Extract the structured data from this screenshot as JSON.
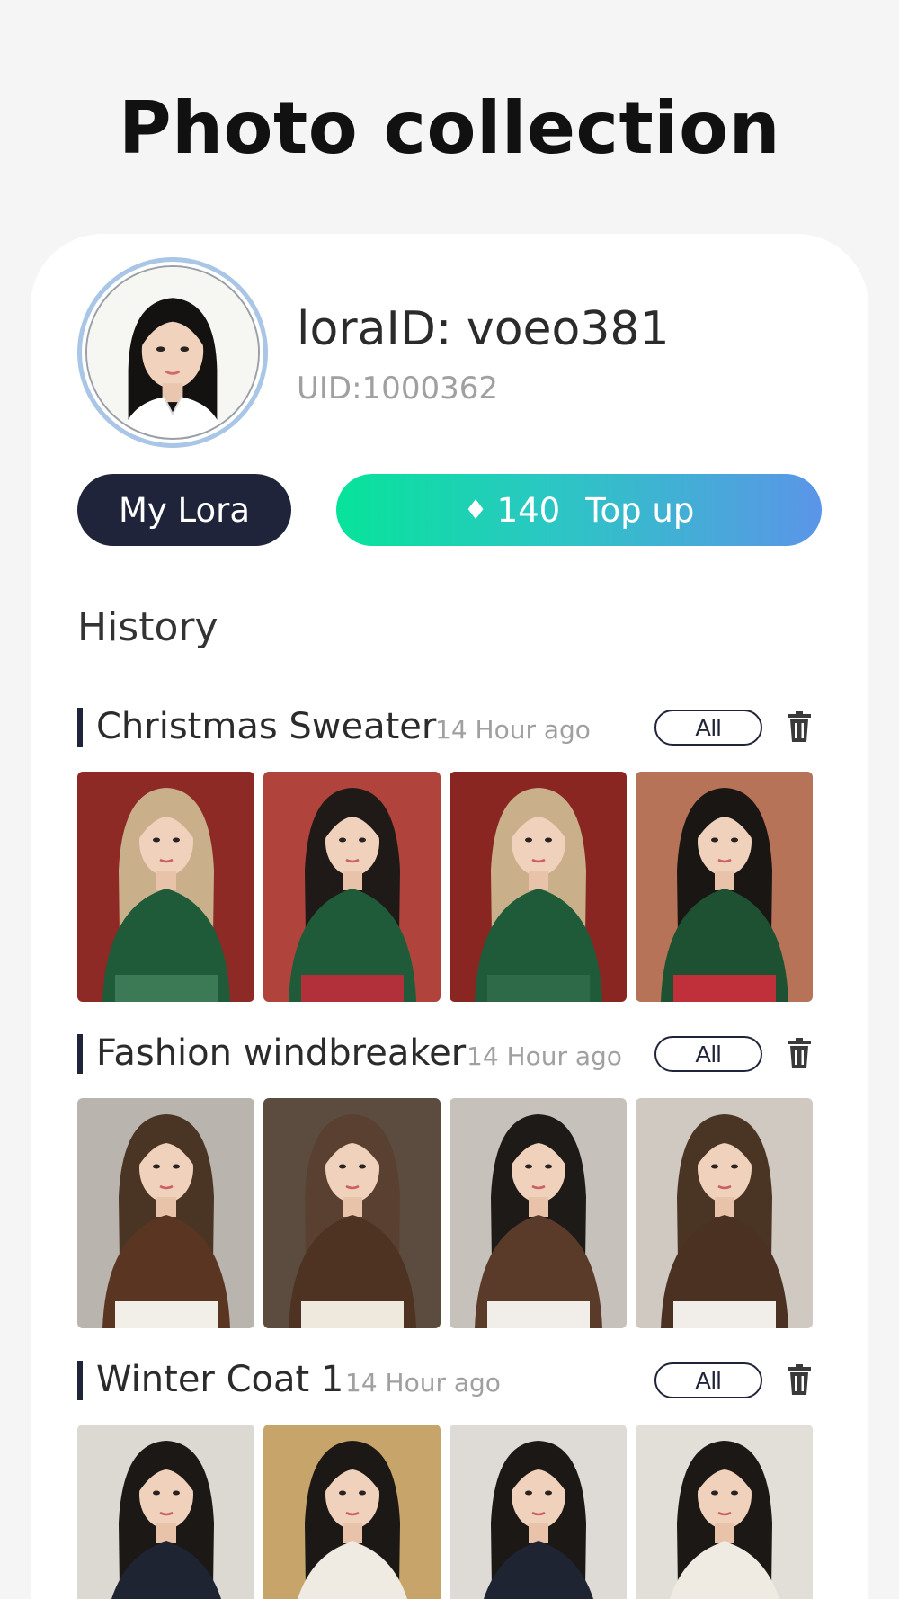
{
  "page": {
    "title": "Photo collection"
  },
  "profile": {
    "lora_id": "loraID: voeo381",
    "uid": "UID:1000362"
  },
  "buttons": {
    "my_lora": "My Lora",
    "gem_icon": "♦",
    "balance": "140",
    "top_up": "Top up"
  },
  "history": {
    "title": "History",
    "sections": [
      {
        "name": "Christmas Sweater",
        "time": "14 Hour ago",
        "all_label": "All",
        "thumbs": [
          {
            "bg": "#8e2a26",
            "hair": "#c9b08a",
            "top": "#1f5a39",
            "bottom": "#3c7a55"
          },
          {
            "bg": "#b0443c",
            "hair": "#1f1a18",
            "top": "#1f5a39",
            "bottom": "#b2303a"
          },
          {
            "bg": "#8a2622",
            "hair": "#c9b08a",
            "top": "#1f5a39",
            "bottom": "#2f6a48"
          },
          {
            "bg": "#b77358",
            "hair": "#1a1614",
            "top": "#1d5132",
            "bottom": "#c0303a"
          }
        ]
      },
      {
        "name": "Fashion windbreaker",
        "time": "14 Hour ago",
        "all_label": "All",
        "thumbs": [
          {
            "bg": "#b9b4ad",
            "hair": "#4a3525",
            "top": "#5a3622",
            "bottom": "#f2efe8"
          },
          {
            "bg": "#5c4c40",
            "hair": "#5a4030",
            "top": "#4e3322",
            "bottom": "#efe8dc"
          },
          {
            "bg": "#c6c1ba",
            "hair": "#1e1a17",
            "top": "#5a3a28",
            "bottom": "#f1eee9"
          },
          {
            "bg": "#cfc9c2",
            "hair": "#4a3525",
            "top": "#4a3122",
            "bottom": "#f1eee9"
          }
        ]
      },
      {
        "name": "Winter Coat 1",
        "time": "14 Hour ago",
        "all_label": "All",
        "thumbs": [
          {
            "bg": "#dcd8d2",
            "hair": "#1c1816",
            "top": "#1f2433",
            "bottom": "#c99a4a"
          },
          {
            "bg": "#c7a46a",
            "hair": "#1c1816",
            "top": "#efeae2",
            "bottom": "#b88a3c"
          },
          {
            "bg": "#dedbd6",
            "hair": "#1c1816",
            "top": "#1f2433",
            "bottom": "#e6d3ac"
          },
          {
            "bg": "#e2ded8",
            "hair": "#1c1816",
            "top": "#efeae2",
            "bottom": "#d4a24a"
          }
        ]
      }
    ]
  }
}
